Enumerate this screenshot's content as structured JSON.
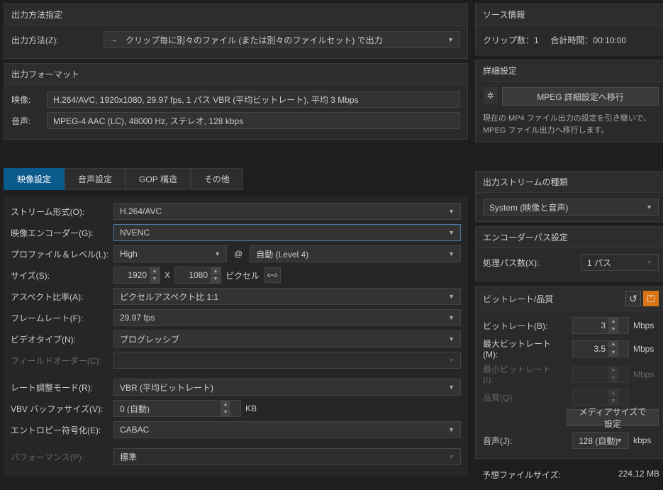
{
  "output_method": {
    "title": "出力方法指定",
    "label": "出力方法(Z):",
    "value": "クリップ毎に別々のファイル (または別々のファイルセット) で出力"
  },
  "source_info": {
    "title": "ソース情報",
    "clips_label": "クリップ数：",
    "clips_value": "1",
    "total_label": "合計時間：",
    "total_value": "00:10:00"
  },
  "output_format": {
    "title": "出力フォーマット",
    "video_label": "映像:",
    "video_value": "H.264/AVC, 1920x1080, 29.97 fps, 1 パス VBR (平均ビットレート), 平均 3 Mbps",
    "audio_label": "音声:",
    "audio_value": "MPEG-4 AAC (LC), 48000 Hz, ステレオ, 128 kbps"
  },
  "advanced": {
    "title": "詳細設定",
    "button": "MPEG 詳細設定へ移行",
    "desc": "現在の MP4 ファイル出力の設定を引き継いで、MPEG ファイル出力へ移行します。"
  },
  "tabs": {
    "video": "映像設定",
    "audio": "音声設定",
    "gop": "GOP 構造",
    "other": "その他"
  },
  "video": {
    "stream_label": "ストリーム形式(O):",
    "stream_value": "H.264/AVC",
    "encoder_label": "映像エンコーダー(G):",
    "encoder_value": "NVENC",
    "profile_label": "プロファイル＆レベル(L):",
    "profile_value": "High",
    "at": "@",
    "level_value": "自動 (Level 4)",
    "size_label": "サイズ(S):",
    "width": "1920",
    "height": "1080",
    "size_unit": "ピクセル",
    "x": "X",
    "aspect_label": "アスペクト比率(A):",
    "aspect_value": "ピクセルアスペクト比 1:1",
    "fps_label": "フレームレート(F):",
    "fps_value": "29.97 fps",
    "vtype_label": "ビデオタイプ(N):",
    "vtype_value": "プログレッシブ",
    "field_label": "フィールドオーダー(C):",
    "rate_label": "レート調整モード(R):",
    "rate_value": "VBR (平均ビットレート)",
    "vbv_label": "VBV バッファサイズ(V):",
    "vbv_value": "0 (自動)",
    "vbv_unit": "KB",
    "entropy_label": "エントロピー符号化(E):",
    "entropy_value": "CABAC",
    "perf_label": "パフォーマンス(P):",
    "perf_value": "標準"
  },
  "out_stream": {
    "title": "出力ストリームの種類",
    "value": "System (映像と音声)"
  },
  "encoder_pass": {
    "title": "エンコーダーパス設定",
    "label": "処理パス数(X):",
    "value": "1 パス"
  },
  "bitrate": {
    "title": "ビットレート/品質",
    "rate_label": "ビットレート(B):",
    "rate_value": "3",
    "max_label": "最大ビットレート(M):",
    "max_value": "3.5",
    "min_label": "最小ビットレート(I):",
    "quality_label": "品質(Q):",
    "unit": "Mbps",
    "media_button": "メディアサイズで設定",
    "audio_label": "音声(J):",
    "audio_value": "128 (自動)",
    "audio_unit": "kbps"
  },
  "footer": {
    "label": "予想ファイルサイズ:",
    "value": "224.12 MB"
  }
}
